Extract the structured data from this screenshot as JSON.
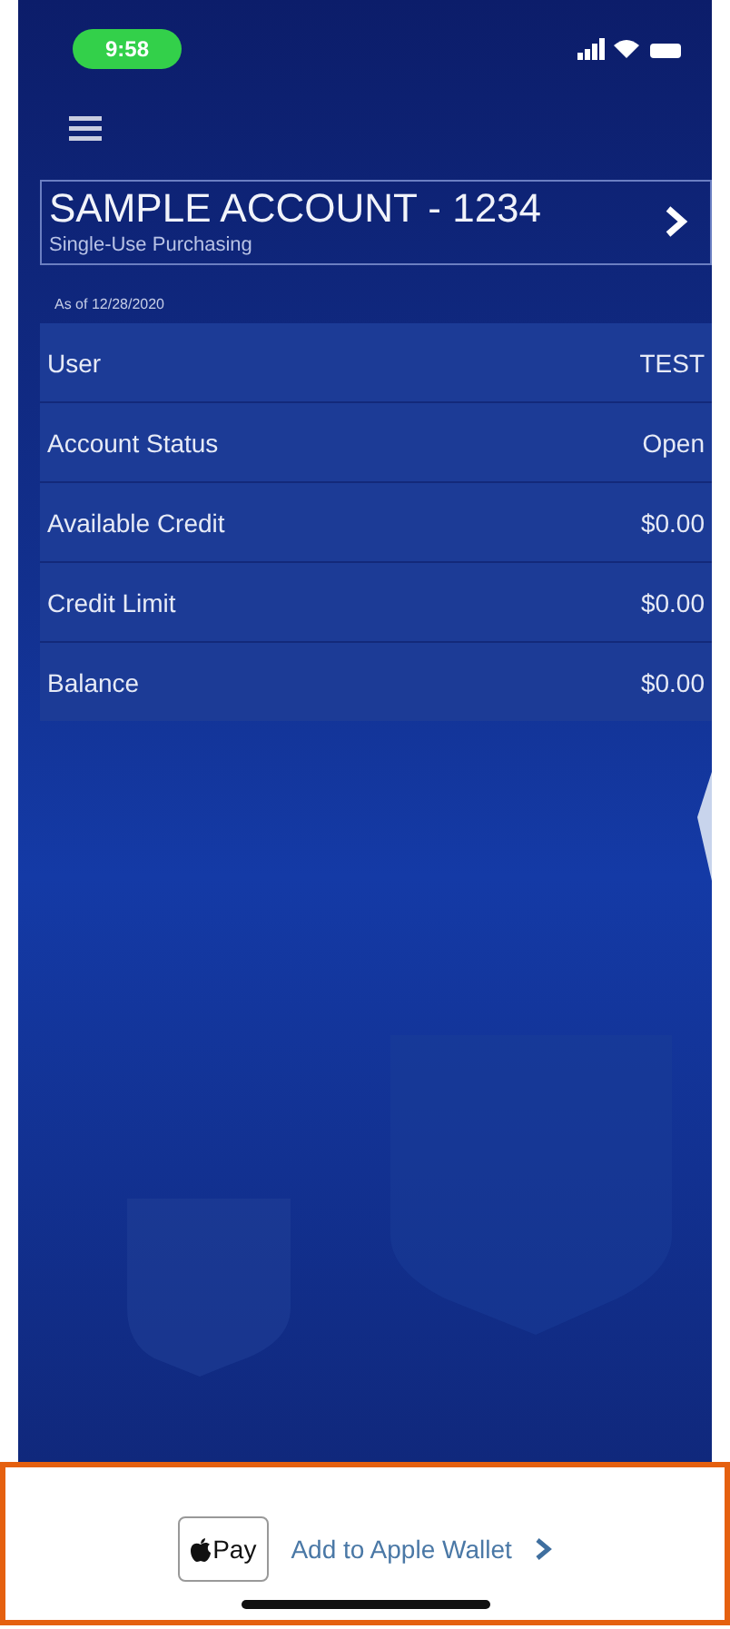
{
  "status_bar": {
    "time": "9:58"
  },
  "account": {
    "name": "SAMPLE ACCOUNT - 1234",
    "subtitle": "Single-Use Purchasing"
  },
  "as_of": "As of 12/28/2020",
  "details": [
    {
      "label": "User",
      "value": "TEST"
    },
    {
      "label": "Account Status",
      "value": "Open"
    },
    {
      "label": "Available Credit",
      "value": "$0.00"
    },
    {
      "label": "Credit Limit",
      "value": "$0.00"
    },
    {
      "label": "Balance",
      "value": "$0.00"
    }
  ],
  "wallet": {
    "badge": "Pay",
    "label": "Add to Apple Wallet"
  }
}
